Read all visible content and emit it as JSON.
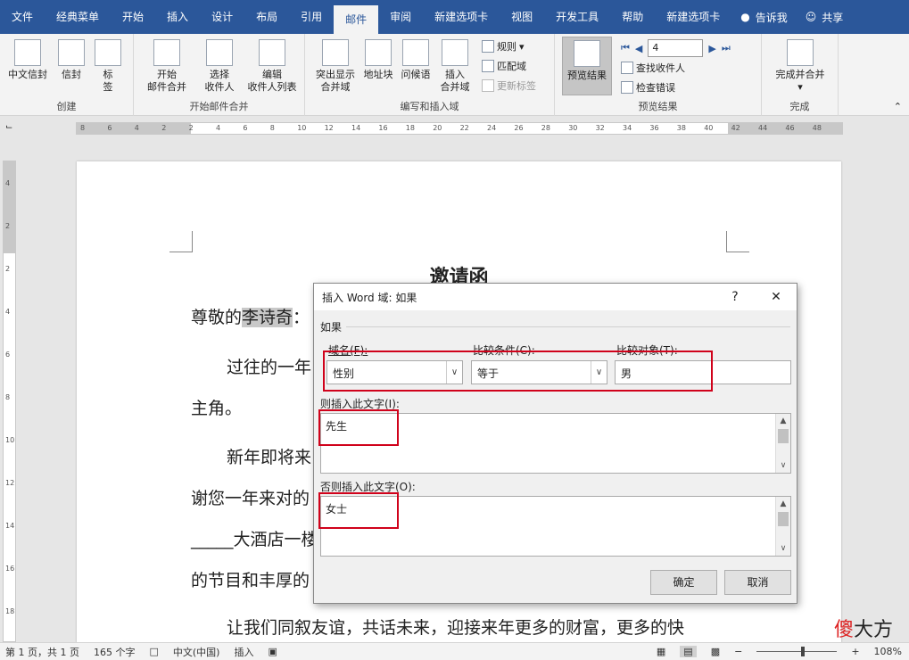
{
  "tabs": [
    "文件",
    "经典菜单",
    "开始",
    "插入",
    "设计",
    "布局",
    "引用",
    "邮件",
    "审阅",
    "新建选项卡",
    "视图",
    "开发工具",
    "帮助",
    "新建选项卡"
  ],
  "tell_me": "告诉我",
  "share": "共享",
  "ribbon": {
    "create": {
      "label": "创建",
      "btn1": "中文信封",
      "btn2": "信封",
      "btn3": "标签"
    },
    "start_merge": {
      "label": "开始邮件合并",
      "btn1_l1": "开始",
      "btn1_l2": "邮件合并",
      "btn2_l1": "选择",
      "btn2_l2": "收件人",
      "btn3_l1": "编辑",
      "btn3_l2": "收件人列表"
    },
    "write_insert": {
      "label": "编写和插入域",
      "btn1_l1": "突出显示",
      "btn1_l2": "合并域",
      "btn2": "地址块",
      "btn3": "问候语",
      "btn4_l1": "插入",
      "btn4_l2": "合并域",
      "rules": "规则",
      "match": "匹配域",
      "update": "更新标签"
    },
    "preview": {
      "label": "预览结果",
      "btn": "预览结果",
      "record": "4",
      "find": "查找收件人",
      "check": "检查错误"
    },
    "finish": {
      "label": "完成",
      "btn": "完成并合并"
    }
  },
  "ruler_numbers": [
    "8",
    "6",
    "4",
    "2",
    "2",
    "4",
    "6",
    "8",
    "10",
    "12",
    "14",
    "16",
    "18",
    "20",
    "22",
    "24",
    "26",
    "28",
    "30",
    "32",
    "34",
    "36",
    "38",
    "40",
    "42",
    "44",
    "46",
    "48"
  ],
  "vruler_numbers": [
    "4",
    "2",
    "2",
    "4",
    "6",
    "8",
    "10",
    "12",
    "14",
    "16",
    "18"
  ],
  "document": {
    "title": "邀请函",
    "greet_prefix": "尊敬的",
    "greet_name": "李诗奇",
    "greet_suffix": "：",
    "p1": "过往的一年",
    "p1b": "主角。",
    "p2": "新年即将来",
    "p2b": "谢您一年来对的",
    "p2c": "_____大酒店一楼",
    "p2d": "的节目和丰厚的",
    "p3": "让我们同叙友谊，共话未来，迎接来年更多的财富，更多的快"
  },
  "dialog": {
    "title": "插入 Word 域: 如果",
    "help": "?",
    "close": "✕",
    "section": "如果",
    "field_name_label": "域名(F):",
    "field_name_value": "性别",
    "compare_label": "比较条件(C):",
    "compare_value": "等于",
    "target_label": "比较对象(T):",
    "target_value": "男",
    "insert_label": "则插入此文字(I):",
    "insert_value": "先生",
    "else_label": "否则插入此文字(O):",
    "else_value": "女士",
    "ok": "确定",
    "cancel": "取消"
  },
  "status": {
    "page": "第 1 页，共 1 页",
    "words": "165 个字",
    "lang": "中文(中国)",
    "mode": "插入",
    "zoom": "108%"
  },
  "watermark": {
    "a": "傻",
    "b": "大方"
  }
}
